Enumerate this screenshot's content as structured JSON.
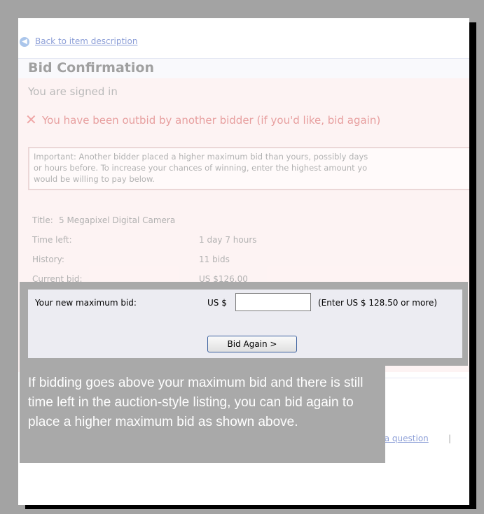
{
  "nav": {
    "back_label": "Back to item description"
  },
  "header": {
    "title": "Bid Confirmation"
  },
  "status": {
    "signed_in": "You are signed in",
    "outbid_message": "You have been outbid by another bidder (if you'd like, bid again)"
  },
  "notice": {
    "text": "Important: Another bidder placed a higher maximum bid than yours, possibly days\nor hours before. To increase your chances of winning, enter the highest amount yo\nwould be willing to pay below."
  },
  "item": {
    "title_label": "Title:",
    "title_value": "5 Megapixel Digital Camera",
    "time_left_label": "Time left:",
    "time_left_value": "1 day 7 hours",
    "history_label": "History:",
    "history_value": "11 bids",
    "current_bid_label": "Current bid:",
    "current_bid_value": "US $126.00"
  },
  "bid_form": {
    "label": "Your new maximum bid:",
    "currency": "US $",
    "input_value": "",
    "hint": "(Enter US $ 128.50 or more)",
    "submit_label": "Bid Again >"
  },
  "footer": {
    "question_link": "r a question",
    "separator": "|"
  },
  "callout": {
    "text": "If bidding goes above your maximum bid and there is still time left in the auction-style listing, you can bid again to place a higher maximum bid as shown above."
  }
}
